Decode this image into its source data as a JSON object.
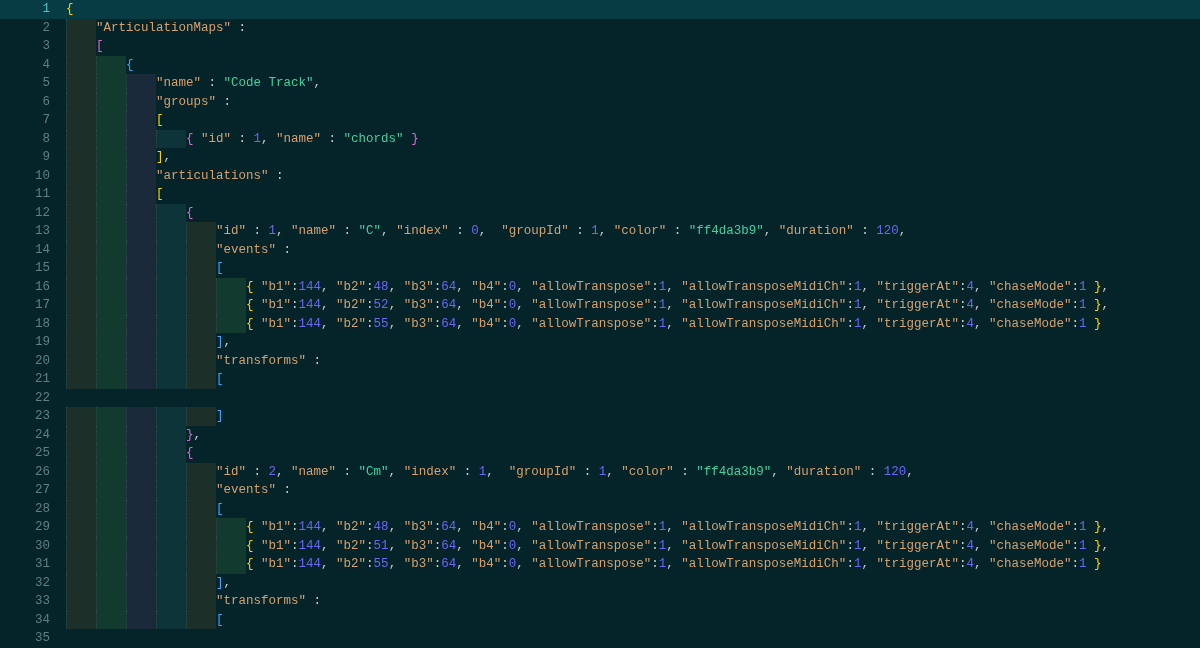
{
  "editor": {
    "lines": [
      {
        "number": "1",
        "current": true,
        "tokens": [
          {
            "kind": "open",
            "text": "{"
          }
        ]
      },
      {
        "number": "2",
        "current": false,
        "tokens": [
          {
            "kind": "key",
            "text": "\"ArticulationMaps\""
          },
          {
            "kind": "punct",
            "text": " :"
          }
        ]
      },
      {
        "number": "3",
        "current": false,
        "tokens": [
          {
            "kind": "open",
            "text": "["
          }
        ]
      },
      {
        "number": "4",
        "current": false,
        "tokens": [
          {
            "kind": "open",
            "text": "{"
          }
        ]
      },
      {
        "number": "5",
        "current": false,
        "tokens": [
          {
            "kind": "key",
            "text": "\"name\""
          },
          {
            "kind": "punct",
            "text": " : "
          },
          {
            "kind": "string",
            "text": "\"Code Track\""
          },
          {
            "kind": "punct",
            "text": ","
          }
        ]
      },
      {
        "number": "6",
        "current": false,
        "tokens": [
          {
            "kind": "key",
            "text": "\"groups\""
          },
          {
            "kind": "punct",
            "text": " :"
          }
        ]
      },
      {
        "number": "7",
        "current": false,
        "tokens": [
          {
            "kind": "open",
            "text": "["
          }
        ]
      },
      {
        "number": "8",
        "current": false,
        "tokens": [
          {
            "kind": "open",
            "text": "{"
          },
          {
            "kind": "key",
            "text": " \"id\""
          },
          {
            "kind": "punct",
            "text": " : "
          },
          {
            "kind": "number",
            "text": "1"
          },
          {
            "kind": "punct",
            "text": ", "
          },
          {
            "kind": "key",
            "text": "\"name\""
          },
          {
            "kind": "punct",
            "text": " : "
          },
          {
            "kind": "string",
            "text": "\"chords\""
          },
          {
            "kind": "close",
            "text": " }"
          }
        ]
      },
      {
        "number": "9",
        "current": false,
        "tokens": [
          {
            "kind": "close",
            "text": "]"
          },
          {
            "kind": "punct",
            "text": ","
          }
        ]
      },
      {
        "number": "10",
        "current": false,
        "tokens": [
          {
            "kind": "key",
            "text": "\"articulations\""
          },
          {
            "kind": "punct",
            "text": " :"
          }
        ]
      },
      {
        "number": "11",
        "current": false,
        "tokens": [
          {
            "kind": "open",
            "text": "["
          }
        ]
      },
      {
        "number": "12",
        "current": false,
        "tokens": [
          {
            "kind": "open",
            "text": "{"
          }
        ]
      },
      {
        "number": "13",
        "current": false,
        "tokens": [
          {
            "kind": "key",
            "text": "\"id\""
          },
          {
            "kind": "punct",
            "text": " : "
          },
          {
            "kind": "number",
            "text": "1"
          },
          {
            "kind": "punct",
            "text": ", "
          },
          {
            "kind": "key",
            "text": "\"name\""
          },
          {
            "kind": "punct",
            "text": " : "
          },
          {
            "kind": "string",
            "text": "\"C\""
          },
          {
            "kind": "punct",
            "text": ", "
          },
          {
            "kind": "key",
            "text": "\"index\""
          },
          {
            "kind": "punct",
            "text": " : "
          },
          {
            "kind": "number",
            "text": "0"
          },
          {
            "kind": "punct",
            "text": ",  "
          },
          {
            "kind": "key",
            "text": "\"groupId\""
          },
          {
            "kind": "punct",
            "text": " : "
          },
          {
            "kind": "number",
            "text": "1"
          },
          {
            "kind": "punct",
            "text": ", "
          },
          {
            "kind": "key",
            "text": "\"color\""
          },
          {
            "kind": "punct",
            "text": " : "
          },
          {
            "kind": "string",
            "text": "\"ff4da3b9\""
          },
          {
            "kind": "punct",
            "text": ", "
          },
          {
            "kind": "key",
            "text": "\"duration\""
          },
          {
            "kind": "punct",
            "text": " : "
          },
          {
            "kind": "number",
            "text": "120"
          },
          {
            "kind": "punct",
            "text": ","
          }
        ]
      },
      {
        "number": "14",
        "current": false,
        "tokens": [
          {
            "kind": "key",
            "text": "\"events\""
          },
          {
            "kind": "punct",
            "text": " :"
          }
        ]
      },
      {
        "number": "15",
        "current": false,
        "tokens": [
          {
            "kind": "open",
            "text": "["
          }
        ]
      },
      {
        "number": "16",
        "current": false,
        "tokens": [
          {
            "kind": "open",
            "text": "{"
          },
          {
            "kind": "key",
            "text": " \"b1\""
          },
          {
            "kind": "punct",
            "text": ":"
          },
          {
            "kind": "number",
            "text": "144"
          },
          {
            "kind": "punct",
            "text": ", "
          },
          {
            "kind": "key",
            "text": "\"b2\""
          },
          {
            "kind": "punct",
            "text": ":"
          },
          {
            "kind": "number",
            "text": "48"
          },
          {
            "kind": "punct",
            "text": ", "
          },
          {
            "kind": "key",
            "text": "\"b3\""
          },
          {
            "kind": "punct",
            "text": ":"
          },
          {
            "kind": "number",
            "text": "64"
          },
          {
            "kind": "punct",
            "text": ", "
          },
          {
            "kind": "key",
            "text": "\"b4\""
          },
          {
            "kind": "punct",
            "text": ":"
          },
          {
            "kind": "number",
            "text": "0"
          },
          {
            "kind": "punct",
            "text": ", "
          },
          {
            "kind": "key",
            "text": "\"allowTranspose\""
          },
          {
            "kind": "punct",
            "text": ":"
          },
          {
            "kind": "number",
            "text": "1"
          },
          {
            "kind": "punct",
            "text": ", "
          },
          {
            "kind": "key",
            "text": "\"allowTransposeMidiCh\""
          },
          {
            "kind": "punct",
            "text": ":"
          },
          {
            "kind": "number",
            "text": "1"
          },
          {
            "kind": "punct",
            "text": ", "
          },
          {
            "kind": "key",
            "text": "\"triggerAt\""
          },
          {
            "kind": "punct",
            "text": ":"
          },
          {
            "kind": "number",
            "text": "4"
          },
          {
            "kind": "punct",
            "text": ", "
          },
          {
            "kind": "key",
            "text": "\"chaseMode\""
          },
          {
            "kind": "punct",
            "text": ":"
          },
          {
            "kind": "number",
            "text": "1"
          },
          {
            "kind": "close",
            "text": " }"
          },
          {
            "kind": "punct",
            "text": ","
          }
        ]
      },
      {
        "number": "17",
        "current": false,
        "tokens": [
          {
            "kind": "open",
            "text": "{"
          },
          {
            "kind": "key",
            "text": " \"b1\""
          },
          {
            "kind": "punct",
            "text": ":"
          },
          {
            "kind": "number",
            "text": "144"
          },
          {
            "kind": "punct",
            "text": ", "
          },
          {
            "kind": "key",
            "text": "\"b2\""
          },
          {
            "kind": "punct",
            "text": ":"
          },
          {
            "kind": "number",
            "text": "52"
          },
          {
            "kind": "punct",
            "text": ", "
          },
          {
            "kind": "key",
            "text": "\"b3\""
          },
          {
            "kind": "punct",
            "text": ":"
          },
          {
            "kind": "number",
            "text": "64"
          },
          {
            "kind": "punct",
            "text": ", "
          },
          {
            "kind": "key",
            "text": "\"b4\""
          },
          {
            "kind": "punct",
            "text": ":"
          },
          {
            "kind": "number",
            "text": "0"
          },
          {
            "kind": "punct",
            "text": ", "
          },
          {
            "kind": "key",
            "text": "\"allowTranspose\""
          },
          {
            "kind": "punct",
            "text": ":"
          },
          {
            "kind": "number",
            "text": "1"
          },
          {
            "kind": "punct",
            "text": ", "
          },
          {
            "kind": "key",
            "text": "\"allowTransposeMidiCh\""
          },
          {
            "kind": "punct",
            "text": ":"
          },
          {
            "kind": "number",
            "text": "1"
          },
          {
            "kind": "punct",
            "text": ", "
          },
          {
            "kind": "key",
            "text": "\"triggerAt\""
          },
          {
            "kind": "punct",
            "text": ":"
          },
          {
            "kind": "number",
            "text": "4"
          },
          {
            "kind": "punct",
            "text": ", "
          },
          {
            "kind": "key",
            "text": "\"chaseMode\""
          },
          {
            "kind": "punct",
            "text": ":"
          },
          {
            "kind": "number",
            "text": "1"
          },
          {
            "kind": "close",
            "text": " }"
          },
          {
            "kind": "punct",
            "text": ","
          }
        ]
      },
      {
        "number": "18",
        "current": false,
        "tokens": [
          {
            "kind": "open",
            "text": "{"
          },
          {
            "kind": "key",
            "text": " \"b1\""
          },
          {
            "kind": "punct",
            "text": ":"
          },
          {
            "kind": "number",
            "text": "144"
          },
          {
            "kind": "punct",
            "text": ", "
          },
          {
            "kind": "key",
            "text": "\"b2\""
          },
          {
            "kind": "punct",
            "text": ":"
          },
          {
            "kind": "number",
            "text": "55"
          },
          {
            "kind": "punct",
            "text": ", "
          },
          {
            "kind": "key",
            "text": "\"b3\""
          },
          {
            "kind": "punct",
            "text": ":"
          },
          {
            "kind": "number",
            "text": "64"
          },
          {
            "kind": "punct",
            "text": ", "
          },
          {
            "kind": "key",
            "text": "\"b4\""
          },
          {
            "kind": "punct",
            "text": ":"
          },
          {
            "kind": "number",
            "text": "0"
          },
          {
            "kind": "punct",
            "text": ", "
          },
          {
            "kind": "key",
            "text": "\"allowTranspose\""
          },
          {
            "kind": "punct",
            "text": ":"
          },
          {
            "kind": "number",
            "text": "1"
          },
          {
            "kind": "punct",
            "text": ", "
          },
          {
            "kind": "key",
            "text": "\"allowTransposeMidiCh\""
          },
          {
            "kind": "punct",
            "text": ":"
          },
          {
            "kind": "number",
            "text": "1"
          },
          {
            "kind": "punct",
            "text": ", "
          },
          {
            "kind": "key",
            "text": "\"triggerAt\""
          },
          {
            "kind": "punct",
            "text": ":"
          },
          {
            "kind": "number",
            "text": "4"
          },
          {
            "kind": "punct",
            "text": ", "
          },
          {
            "kind": "key",
            "text": "\"chaseMode\""
          },
          {
            "kind": "punct",
            "text": ":"
          },
          {
            "kind": "number",
            "text": "1"
          },
          {
            "kind": "close",
            "text": " }"
          }
        ]
      },
      {
        "number": "19",
        "current": false,
        "tokens": [
          {
            "kind": "close",
            "text": "]"
          },
          {
            "kind": "punct",
            "text": ","
          }
        ]
      },
      {
        "number": "20",
        "current": false,
        "tokens": [
          {
            "kind": "key",
            "text": "\"transforms\""
          },
          {
            "kind": "punct",
            "text": " :"
          }
        ]
      },
      {
        "number": "21",
        "current": false,
        "tokens": [
          {
            "kind": "open",
            "text": "["
          }
        ]
      },
      {
        "number": "22",
        "current": false
      },
      {
        "number": "23",
        "current": false,
        "tokens": [
          {
            "kind": "close",
            "text": "]"
          }
        ]
      },
      {
        "number": "24",
        "current": false,
        "tokens": [
          {
            "kind": "close",
            "text": "}"
          },
          {
            "kind": "punct",
            "text": ","
          }
        ]
      },
      {
        "number": "25",
        "current": false,
        "tokens": [
          {
            "kind": "open",
            "text": "{"
          }
        ]
      },
      {
        "number": "26",
        "current": false,
        "tokens": [
          {
            "kind": "key",
            "text": "\"id\""
          },
          {
            "kind": "punct",
            "text": " : "
          },
          {
            "kind": "number",
            "text": "2"
          },
          {
            "kind": "punct",
            "text": ", "
          },
          {
            "kind": "key",
            "text": "\"name\""
          },
          {
            "kind": "punct",
            "text": " : "
          },
          {
            "kind": "string",
            "text": "\"Cm\""
          },
          {
            "kind": "punct",
            "text": ", "
          },
          {
            "kind": "key",
            "text": "\"index\""
          },
          {
            "kind": "punct",
            "text": " : "
          },
          {
            "kind": "number",
            "text": "1"
          },
          {
            "kind": "punct",
            "text": ",  "
          },
          {
            "kind": "key",
            "text": "\"groupId\""
          },
          {
            "kind": "punct",
            "text": " : "
          },
          {
            "kind": "number",
            "text": "1"
          },
          {
            "kind": "punct",
            "text": ", "
          },
          {
            "kind": "key",
            "text": "\"color\""
          },
          {
            "kind": "punct",
            "text": " : "
          },
          {
            "kind": "string",
            "text": "\"ff4da3b9\""
          },
          {
            "kind": "punct",
            "text": ", "
          },
          {
            "kind": "key",
            "text": "\"duration\""
          },
          {
            "kind": "punct",
            "text": " : "
          },
          {
            "kind": "number",
            "text": "120"
          },
          {
            "kind": "punct",
            "text": ","
          }
        ]
      },
      {
        "number": "27",
        "current": false,
        "tokens": [
          {
            "kind": "key",
            "text": "\"events\""
          },
          {
            "kind": "punct",
            "text": " :"
          }
        ]
      },
      {
        "number": "28",
        "current": false,
        "tokens": [
          {
            "kind": "open",
            "text": "["
          }
        ]
      },
      {
        "number": "29",
        "current": false,
        "tokens": [
          {
            "kind": "open",
            "text": "{"
          },
          {
            "kind": "key",
            "text": " \"b1\""
          },
          {
            "kind": "punct",
            "text": ":"
          },
          {
            "kind": "number",
            "text": "144"
          },
          {
            "kind": "punct",
            "text": ", "
          },
          {
            "kind": "key",
            "text": "\"b2\""
          },
          {
            "kind": "punct",
            "text": ":"
          },
          {
            "kind": "number",
            "text": "48"
          },
          {
            "kind": "punct",
            "text": ", "
          },
          {
            "kind": "key",
            "text": "\"b3\""
          },
          {
            "kind": "punct",
            "text": ":"
          },
          {
            "kind": "number",
            "text": "64"
          },
          {
            "kind": "punct",
            "text": ", "
          },
          {
            "kind": "key",
            "text": "\"b4\""
          },
          {
            "kind": "punct",
            "text": ":"
          },
          {
            "kind": "number",
            "text": "0"
          },
          {
            "kind": "punct",
            "text": ", "
          },
          {
            "kind": "key",
            "text": "\"allowTranspose\""
          },
          {
            "kind": "punct",
            "text": ":"
          },
          {
            "kind": "number",
            "text": "1"
          },
          {
            "kind": "punct",
            "text": ", "
          },
          {
            "kind": "key",
            "text": "\"allowTransposeMidiCh\""
          },
          {
            "kind": "punct",
            "text": ":"
          },
          {
            "kind": "number",
            "text": "1"
          },
          {
            "kind": "punct",
            "text": ", "
          },
          {
            "kind": "key",
            "text": "\"triggerAt\""
          },
          {
            "kind": "punct",
            "text": ":"
          },
          {
            "kind": "number",
            "text": "4"
          },
          {
            "kind": "punct",
            "text": ", "
          },
          {
            "kind": "key",
            "text": "\"chaseMode\""
          },
          {
            "kind": "punct",
            "text": ":"
          },
          {
            "kind": "number",
            "text": "1"
          },
          {
            "kind": "close",
            "text": " }"
          },
          {
            "kind": "punct",
            "text": ","
          }
        ]
      },
      {
        "number": "30",
        "current": false,
        "tokens": [
          {
            "kind": "open",
            "text": "{"
          },
          {
            "kind": "key",
            "text": " \"b1\""
          },
          {
            "kind": "punct",
            "text": ":"
          },
          {
            "kind": "number",
            "text": "144"
          },
          {
            "kind": "punct",
            "text": ", "
          },
          {
            "kind": "key",
            "text": "\"b2\""
          },
          {
            "kind": "punct",
            "text": ":"
          },
          {
            "kind": "number",
            "text": "51"
          },
          {
            "kind": "punct",
            "text": ", "
          },
          {
            "kind": "key",
            "text": "\"b3\""
          },
          {
            "kind": "punct",
            "text": ":"
          },
          {
            "kind": "number",
            "text": "64"
          },
          {
            "kind": "punct",
            "text": ", "
          },
          {
            "kind": "key",
            "text": "\"b4\""
          },
          {
            "kind": "punct",
            "text": ":"
          },
          {
            "kind": "number",
            "text": "0"
          },
          {
            "kind": "punct",
            "text": ", "
          },
          {
            "kind": "key",
            "text": "\"allowTranspose\""
          },
          {
            "kind": "punct",
            "text": ":"
          },
          {
            "kind": "number",
            "text": "1"
          },
          {
            "kind": "punct",
            "text": ", "
          },
          {
            "kind": "key",
            "text": "\"allowTransposeMidiCh\""
          },
          {
            "kind": "punct",
            "text": ":"
          },
          {
            "kind": "number",
            "text": "1"
          },
          {
            "kind": "punct",
            "text": ", "
          },
          {
            "kind": "key",
            "text": "\"triggerAt\""
          },
          {
            "kind": "punct",
            "text": ":"
          },
          {
            "kind": "number",
            "text": "4"
          },
          {
            "kind": "punct",
            "text": ", "
          },
          {
            "kind": "key",
            "text": "\"chaseMode\""
          },
          {
            "kind": "punct",
            "text": ":"
          },
          {
            "kind": "number",
            "text": "1"
          },
          {
            "kind": "close",
            "text": " }"
          },
          {
            "kind": "punct",
            "text": ","
          }
        ]
      },
      {
        "number": "31",
        "current": false,
        "tokens": [
          {
            "kind": "open",
            "text": "{"
          },
          {
            "kind": "key",
            "text": " \"b1\""
          },
          {
            "kind": "punct",
            "text": ":"
          },
          {
            "kind": "number",
            "text": "144"
          },
          {
            "kind": "punct",
            "text": ", "
          },
          {
            "kind": "key",
            "text": "\"b2\""
          },
          {
            "kind": "punct",
            "text": ":"
          },
          {
            "kind": "number",
            "text": "55"
          },
          {
            "kind": "punct",
            "text": ", "
          },
          {
            "kind": "key",
            "text": "\"b3\""
          },
          {
            "kind": "punct",
            "text": ":"
          },
          {
            "kind": "number",
            "text": "64"
          },
          {
            "kind": "punct",
            "text": ", "
          },
          {
            "kind": "key",
            "text": "\"b4\""
          },
          {
            "kind": "punct",
            "text": ":"
          },
          {
            "kind": "number",
            "text": "0"
          },
          {
            "kind": "punct",
            "text": ", "
          },
          {
            "kind": "key",
            "text": "\"allowTranspose\""
          },
          {
            "kind": "punct",
            "text": ":"
          },
          {
            "kind": "number",
            "text": "1"
          },
          {
            "kind": "punct",
            "text": ", "
          },
          {
            "kind": "key",
            "text": "\"allowTransposeMidiCh\""
          },
          {
            "kind": "punct",
            "text": ":"
          },
          {
            "kind": "number",
            "text": "1"
          },
          {
            "kind": "punct",
            "text": ", "
          },
          {
            "kind": "key",
            "text": "\"triggerAt\""
          },
          {
            "kind": "punct",
            "text": ":"
          },
          {
            "kind": "number",
            "text": "4"
          },
          {
            "kind": "punct",
            "text": ", "
          },
          {
            "kind": "key",
            "text": "\"chaseMode\""
          },
          {
            "kind": "punct",
            "text": ":"
          },
          {
            "kind": "number",
            "text": "1"
          },
          {
            "kind": "close",
            "text": " }"
          }
        ]
      },
      {
        "number": "32",
        "current": false,
        "tokens": [
          {
            "kind": "close",
            "text": "]"
          },
          {
            "kind": "punct",
            "text": ","
          }
        ]
      },
      {
        "number": "33",
        "current": false,
        "tokens": [
          {
            "kind": "key",
            "text": "\"transforms\""
          },
          {
            "kind": "punct",
            "text": " :"
          }
        ]
      },
      {
        "number": "34",
        "current": false,
        "tokens": [
          {
            "kind": "open",
            "text": "["
          }
        ]
      },
      {
        "number": "35",
        "current": false
      }
    ]
  }
}
